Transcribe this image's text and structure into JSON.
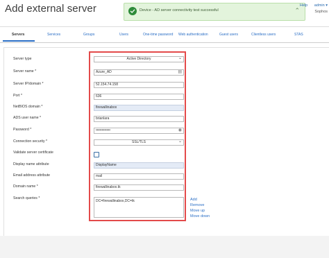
{
  "header": {
    "title": "Add external server",
    "help": "Help",
    "admin": "admin ▾",
    "brand": "Sophos"
  },
  "toast": {
    "message": "Device - AD server connectivity test successful",
    "close": "⌃",
    "color": "#2e8b3a"
  },
  "tabs": [
    {
      "label": "Servers",
      "active": true
    },
    {
      "label": "Services"
    },
    {
      "label": "Groups"
    },
    {
      "label": "Users"
    },
    {
      "label": "One-time password"
    },
    {
      "label": "Web authentication"
    },
    {
      "label": "Guest users"
    },
    {
      "label": "Clientless users"
    },
    {
      "label": "STAS"
    }
  ],
  "form": {
    "server_type": {
      "label": "Server type",
      "value": "Active Directory"
    },
    "server_name": {
      "label": "Server name *",
      "value": "Azure_AD"
    },
    "server_ip": {
      "label": "Server IP/domain *",
      "value": "52.154.74.158"
    },
    "port": {
      "label": "Port *",
      "value": "636"
    },
    "netbios": {
      "label": "NetBIOS domain *",
      "value": "firewallinabox"
    },
    "ads_user": {
      "label": "ADS user name *",
      "value": "brianlara"
    },
    "password": {
      "label": "Password *",
      "value": "••••••••••••"
    },
    "conn_security": {
      "label": "Connection security *",
      "value": "SSL/TLS"
    },
    "validate_cert": {
      "label": "Validate server certificate"
    },
    "display_name": {
      "label": "Display name attribute",
      "value": "DisplayName"
    },
    "email_attr": {
      "label": "Email address attribute",
      "value": "mail"
    },
    "domain_name": {
      "label": "Domain name *",
      "value": "firewallinabox.tk"
    },
    "search_queries": {
      "label": "Search queries *",
      "value": "DC=firewallinabox,DC=tk"
    }
  },
  "query_actions": {
    "add": "Add",
    "remove": "Remove",
    "move_up": "Move up",
    "move_down": "Move down"
  },
  "accent_color": "#2a6ec5",
  "highlight_color": "#e34a4a"
}
